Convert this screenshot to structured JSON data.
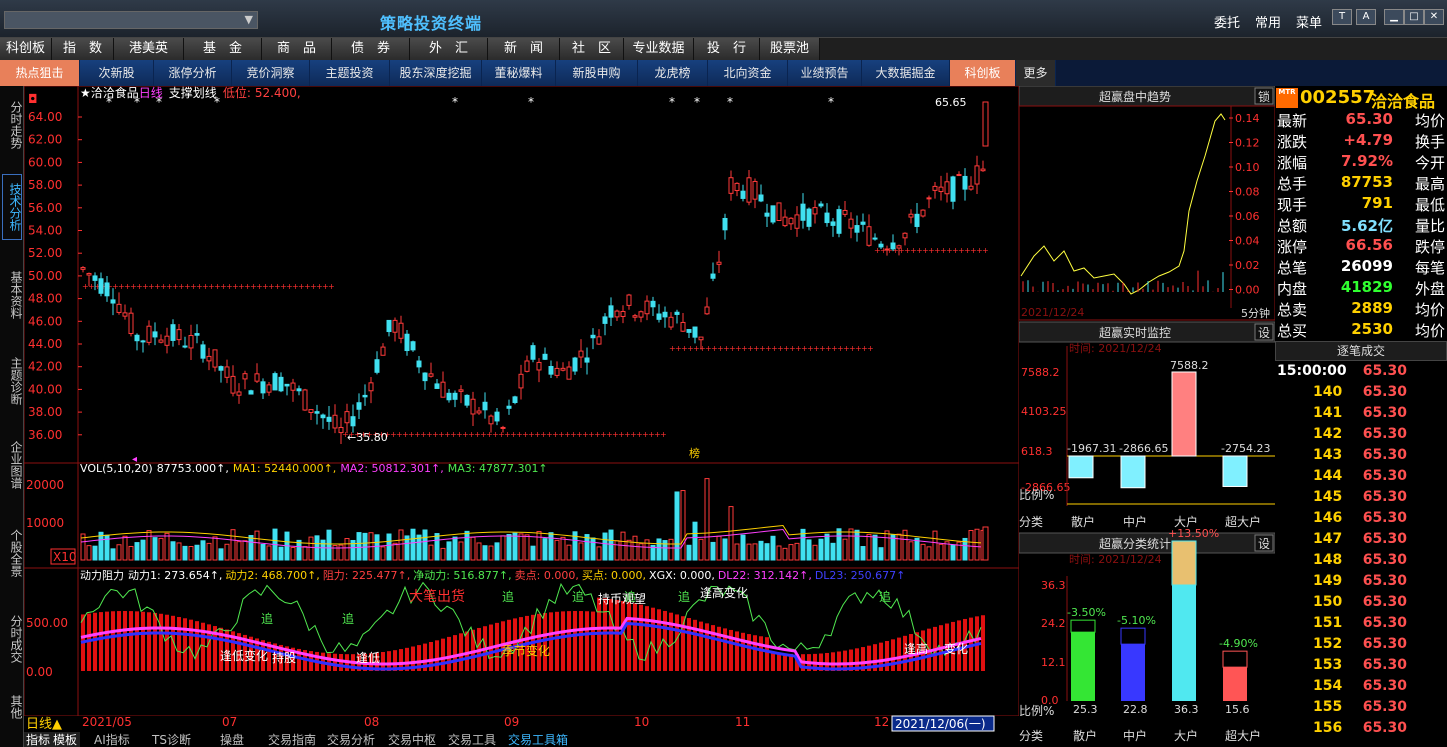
{
  "app": {
    "title": "策略投资终端",
    "code_input": "",
    "top_links": [
      "委托",
      "常用",
      "菜单"
    ],
    "window_buttons": [
      "T",
      "A",
      "minimize",
      "maximize",
      "close"
    ]
  },
  "menu": [
    "科创板",
    "指　数",
    "港美英",
    "基　金",
    "商　品",
    "债　券",
    "外　汇",
    "新　闻",
    "社　区",
    "专业数据",
    "投　行",
    "股票池"
  ],
  "subnav": [
    "热点狙击",
    "次新股",
    "涨停分析",
    "竞价洞察",
    "主题投资",
    "股东深度挖掘",
    "董秘爆料",
    "新股申购",
    "龙虎榜",
    "北向资金",
    "业绩预告",
    "大数据掘金",
    "科创板",
    "更多"
  ],
  "side_tabs": [
    "分时走势",
    "技术分析",
    "基本资料",
    "主题诊断",
    "企业图谱",
    "个股全景",
    "分时成交",
    "其他"
  ],
  "chart": {
    "header": {
      "star": "★",
      "name": "洽洽食品",
      "period": "日线",
      "indicator": "支撑划线",
      "low_label": "低位:",
      "low_value": "52.400,"
    },
    "price_axis": [
      "64.00",
      "62.00",
      "60.00",
      "58.00",
      "56.00",
      "54.00",
      "52.00",
      "50.00",
      "48.00",
      "46.00",
      "44.00",
      "42.00",
      "40.00",
      "38.00",
      "36.00"
    ],
    "annotations": {
      "high": "65.65",
      "low": "35.80",
      "bang": "榜"
    },
    "vol_header": {
      "label": "VOL(5,10,20)",
      "vol": "87753.000↑,",
      "ma1": "MA1: 52440.000↑,",
      "ma2": "MA2: 50812.301↑,",
      "ma3": "MA3: 47877.301↑"
    },
    "vol_axis": [
      "20000",
      "10000"
    ],
    "vol_unit": "X10",
    "ind_header": {
      "name": "动力阻力",
      "d1": "动力1: 273.654↑,",
      "d2": "动力2: 468.700↑,",
      "zl": "阻力: 225.477↑,",
      "jd": "净动力: 516.877↑,",
      "sell": "卖点: 0.000,",
      "buy": "买点: 0.000,",
      "xgx": "XGX: 0.000,",
      "dl22": "DL22: 312.142↑,",
      "dl23": "DL23: 250.677↑"
    },
    "ind_axis": [
      "500.00",
      "0.00"
    ],
    "ind_labels": [
      "大笔出货",
      "追",
      "追",
      "追",
      "追",
      "追",
      "追",
      "追",
      "持币观望",
      "逢高变化",
      "逢低变化",
      "季节变化",
      "逢低",
      "持股",
      "逢高",
      "变化"
    ],
    "date_axis": [
      "2021/05",
      "07",
      "08",
      "09",
      "10",
      "11",
      "12"
    ],
    "current_date": "2021/12/06(一)",
    "period_label": "日线▲",
    "bottom_tabs": [
      "指标",
      "模板",
      "AI指标",
      "TS诊断",
      "操盘",
      "交易指南",
      "交易分析",
      "交易中枢",
      "交易工具",
      "交易工具箱"
    ]
  },
  "intraday_panel": {
    "title": "超赢盘中趋势",
    "lock": "锁",
    "axis": [
      "0.14",
      "0.12",
      "0.10",
      "0.08",
      "0.06",
      "0.04",
      "0.02",
      "0.00"
    ],
    "date": "2021/12/24",
    "period": "5分钟"
  },
  "monitor_panel": {
    "title": "超赢实时监控",
    "set": "设",
    "time": "时间: 2021/12/24",
    "axis": [
      "7588.2",
      "4103.25",
      "618.3",
      "-2866.65"
    ],
    "ratio_label": "比例%",
    "cat_label": "分类",
    "categories": [
      "散户",
      "中户",
      "大户",
      "超大户"
    ],
    "values": [
      -1967.31,
      -2866.65,
      7588.2,
      -2754.23
    ],
    "value_labels": [
      "-1967.31",
      "-2866.65",
      "7588.2",
      "-2754.23"
    ]
  },
  "stats_panel": {
    "title": "超赢分类统计",
    "set": "设",
    "time": "时间: 2021/12/24",
    "axis": [
      "36.3",
      "24.2",
      "12.1",
      "0.0"
    ],
    "ratio_label": "比例%",
    "cat_label": "分类",
    "categories": [
      "散户",
      "中户",
      "大户",
      "超大户"
    ],
    "ratios": [
      25.3,
      22.8,
      36.3,
      15.6
    ],
    "ratio_labels": [
      "25.3",
      "22.8",
      "36.3",
      "15.6"
    ],
    "changes": [
      "-3.50%",
      "-5.10%",
      "+13.50%",
      "-4.90%"
    ],
    "colors": [
      "#34e634",
      "#3838ff",
      "#50e8f0",
      "#ff5555"
    ]
  },
  "quote": {
    "logo": "MTR",
    "code": "002557",
    "name": "洽洽食品",
    "rows": [
      {
        "k": "最新",
        "v": "65.30",
        "k2": "均价",
        "c": "#ff5050"
      },
      {
        "k": "涨跌",
        "v": "+4.79",
        "k2": "换手",
        "c": "#ff5050"
      },
      {
        "k": "涨幅",
        "v": "7.92%",
        "k2": "今开",
        "c": "#ff5050"
      },
      {
        "k": "总手",
        "v": "87753",
        "k2": "最高",
        "c": "#ffd000"
      },
      {
        "k": "现手",
        "v": "791",
        "k2": "最低",
        "c": "#ffd000"
      },
      {
        "k": "总额",
        "v": "5.62亿",
        "k2": "量比",
        "c": "#80e0ff"
      },
      {
        "k": "涨停",
        "v": "66.56",
        "k2": "跌停",
        "c": "#ff5050"
      },
      {
        "k": "总笔",
        "v": "26099",
        "k2": "每笔",
        "c": "#ffffff"
      },
      {
        "k": "内盘",
        "v": "41829",
        "k2": "外盘",
        "c": "#30ff30"
      },
      {
        "k": "总卖",
        "v": "2889",
        "k2": "均价",
        "c": "#ffd000"
      },
      {
        "k": "总买",
        "v": "2530",
        "k2": "均价",
        "c": "#ffd000"
      }
    ]
  },
  "ticks": {
    "title": "逐笔成交",
    "rows": [
      {
        "t": "15:00:00",
        "p": "65.30"
      },
      {
        "t": "140",
        "p": "65.30"
      },
      {
        "t": "141",
        "p": "65.30"
      },
      {
        "t": "142",
        "p": "65.30"
      },
      {
        "t": "143",
        "p": "65.30"
      },
      {
        "t": "144",
        "p": "65.30"
      },
      {
        "t": "145",
        "p": "65.30"
      },
      {
        "t": "146",
        "p": "65.30"
      },
      {
        "t": "147",
        "p": "65.30"
      },
      {
        "t": "148",
        "p": "65.30"
      },
      {
        "t": "149",
        "p": "65.30"
      },
      {
        "t": "150",
        "p": "65.30"
      },
      {
        "t": "151",
        "p": "65.30"
      },
      {
        "t": "152",
        "p": "65.30"
      },
      {
        "t": "153",
        "p": "65.30"
      },
      {
        "t": "154",
        "p": "65.30"
      },
      {
        "t": "155",
        "p": "65.30"
      },
      {
        "t": "156",
        "p": "65.30"
      }
    ]
  }
}
